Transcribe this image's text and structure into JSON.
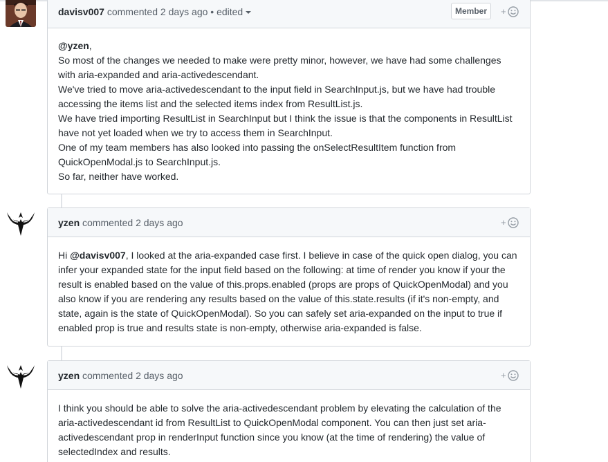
{
  "comments": [
    {
      "author": "davisv007",
      "action": "commented",
      "time": "2 days ago",
      "edited_sep": "•",
      "edited": "edited",
      "badge": "Member",
      "avatar_icon": "user-photo-avatar",
      "reaction_plus": "+",
      "body": [
        {
          "mention": "@yzen",
          "text": ","
        },
        {
          "text": "So most of the changes we needed to make were pretty minor, however, we have had some challenges with aria-expanded and aria-activedescendant."
        },
        {
          "text": "We've tried to move aria-activedescendant to the input field in SearchInput.js, but we have had trouble accessing the items list and the selected items index from ResultList.js."
        },
        {
          "text": "We have tried importing ResultList in SearchInput but I think the issue is that the components in ResultList have not yet loaded when we try to access them in SearchInput."
        },
        {
          "text": "One of my team members has also looked into passing the onSelectResultItem function from QuickOpenModal.js to SearchInput.js."
        },
        {
          "text": "So far, neither have worked."
        }
      ]
    },
    {
      "author": "yzen",
      "action": "commented",
      "time": "2 days ago",
      "avatar_icon": "winged-emblem-avatar",
      "reaction_plus": "+",
      "body_prefix": "Hi ",
      "body_mention": "@davisv007",
      "body_text": ", I looked at the aria-expanded case first. I believe in case of the quick open dialog, you can infer your expanded state for the input field based on the following: at time of render you know if your the result is enabled based on the value of this.props.enabled (props are props of QuickOpenModal) and you also know if you are rendering any results based on the value of this.state.results (if it's non-empty, and state, again is the state of QuickOpenModal). So you can safely set aria-expanded on the input to true if enabled prop is true and results state is non-empty, otherwise aria-expanded is false."
    },
    {
      "author": "yzen",
      "action": "commented",
      "time": "2 days ago",
      "avatar_icon": "winged-emblem-avatar",
      "reaction_plus": "+",
      "body_text": "I think you should be able to solve the aria-activedescendant problem by elevating the calculation of the aria-activedescendant id from ResultList to QuickOpenModal component. You can then just set aria-activedescendant prop in renderInput function since you know (at the time of rendering) the value of selectedIndex and results."
    }
  ],
  "colors": {
    "header_bg": "#f6f8fa",
    "border": "#d1d5da",
    "text": "#24292e",
    "muted": "#586069"
  }
}
